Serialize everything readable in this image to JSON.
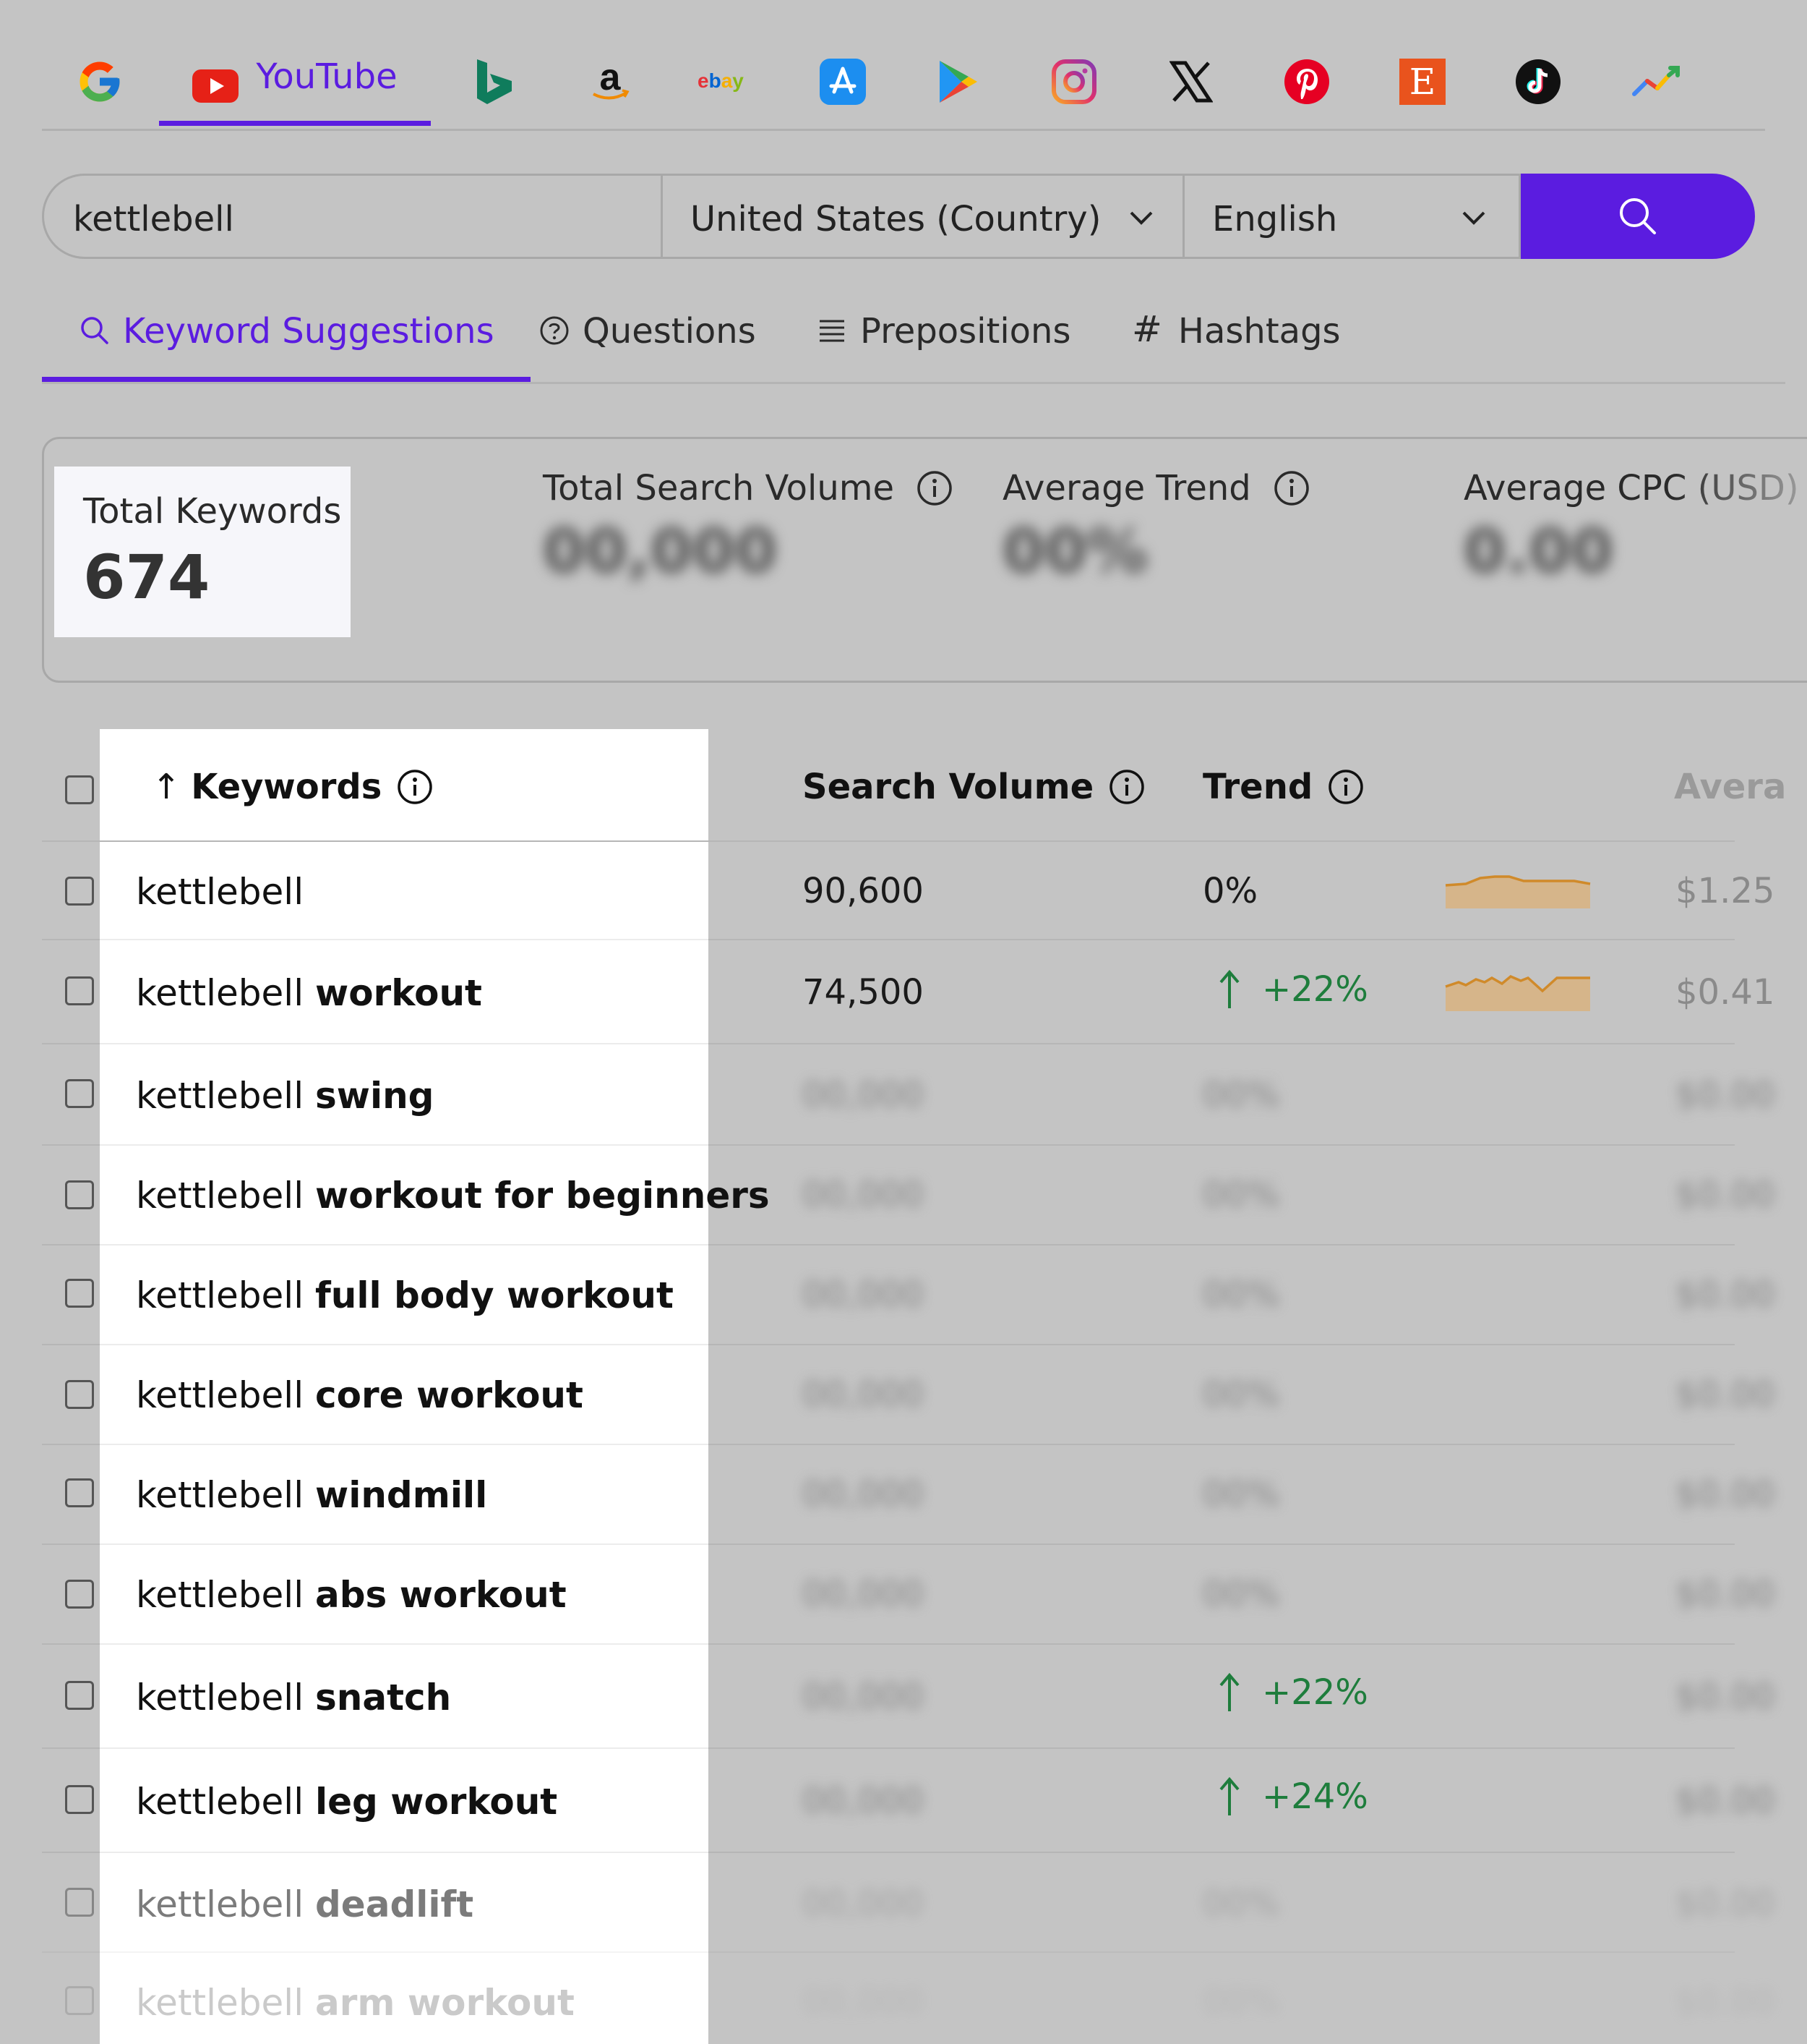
{
  "platforms": {
    "items": [
      {
        "id": "google",
        "icon": "google-icon"
      },
      {
        "id": "youtube",
        "icon": "youtube-icon",
        "label": "YouTube",
        "active": true
      },
      {
        "id": "bing",
        "icon": "bing-icon"
      },
      {
        "id": "amazon",
        "icon": "amazon-icon"
      },
      {
        "id": "ebay",
        "icon": "ebay-icon",
        "label": "ebay"
      },
      {
        "id": "appstore",
        "icon": "app-store-icon"
      },
      {
        "id": "playstore",
        "icon": "play-store-icon"
      },
      {
        "id": "instagram",
        "icon": "instagram-icon"
      },
      {
        "id": "x",
        "icon": "x-icon"
      },
      {
        "id": "pinterest",
        "icon": "pinterest-icon"
      },
      {
        "id": "etsy",
        "icon": "etsy-icon",
        "label": "E"
      },
      {
        "id": "tiktok",
        "icon": "tiktok-icon"
      },
      {
        "id": "trends",
        "icon": "trends-icon"
      }
    ]
  },
  "search": {
    "query": "kettlebell",
    "country": "United States (Country)",
    "language": "English",
    "button_icon": "search-icon"
  },
  "subtabs": [
    {
      "label": "Keyword Suggestions",
      "icon": "search-icon",
      "active": true
    },
    {
      "label": "Questions",
      "icon": "question-icon"
    },
    {
      "label": "Prepositions",
      "icon": "list-icon"
    },
    {
      "label": "Hashtags",
      "icon": "hash-icon",
      "glyph": "#"
    }
  ],
  "stats": {
    "total_keywords_label": "Total Keywords",
    "total_keywords_value": "674",
    "total_search_volume_label": "Total Search Volume",
    "total_search_volume_value": "00,000",
    "average_trend_label": "Average Trend",
    "average_trend_value": "00%",
    "average_cpc_label": "Average CPC (USD)",
    "average_cpc_value": "0.00"
  },
  "table": {
    "headers": {
      "sort_arrow": "↑",
      "keywords": "Keywords",
      "search_volume": "Search Volume",
      "trend": "Trend",
      "cpc": "Avera"
    },
    "rows": [
      {
        "base": "kettlebell",
        "suffix": "",
        "volume": "90,600",
        "trend": "0%",
        "trend_dir": "flat",
        "cpc": "$1.25",
        "spark": "flat"
      },
      {
        "base": "kettlebell",
        "suffix": "workout",
        "volume": "74,500",
        "trend": "+22%",
        "trend_dir": "up",
        "cpc": "$0.41",
        "spark": "wavy"
      },
      {
        "base": "kettlebell",
        "suffix": "swing",
        "volume": "00,000",
        "trend": "00%",
        "trend_dir": "hidden",
        "cpc": "$0.00"
      },
      {
        "base": "kettlebell",
        "suffix": "workout for beginners",
        "volume": "00,000",
        "trend": "00%",
        "trend_dir": "hidden",
        "cpc": "$0.00"
      },
      {
        "base": "kettlebell",
        "suffix": "full body workout",
        "volume": "00,000",
        "trend": "00%",
        "trend_dir": "hidden",
        "cpc": "$0.00"
      },
      {
        "base": "kettlebell",
        "suffix": "core workout",
        "volume": "00,000",
        "trend": "00%",
        "trend_dir": "hidden",
        "cpc": "$0.00"
      },
      {
        "base": "kettlebell",
        "suffix": "windmill",
        "volume": "00,000",
        "trend": "00%",
        "trend_dir": "hidden",
        "cpc": "$0.00"
      },
      {
        "base": "kettlebell",
        "suffix": "abs workout",
        "volume": "00,000",
        "trend": "00%",
        "trend_dir": "hidden",
        "cpc": "$0.00"
      },
      {
        "base": "kettlebell",
        "suffix": "snatch",
        "volume": "00,000",
        "trend": "+22%",
        "trend_dir": "up",
        "cpc": "$0.00"
      },
      {
        "base": "kettlebell",
        "suffix": "leg workout",
        "volume": "00,000",
        "trend": "+24%",
        "trend_dir": "up",
        "cpc": "$0.00"
      },
      {
        "base": "kettlebell",
        "suffix": "deadlift",
        "volume": "00,000",
        "trend": "00%",
        "trend_dir": "hidden",
        "cpc": "$0.00"
      },
      {
        "base": "kettlebell",
        "suffix": "arm workout",
        "volume": "00,000",
        "trend": "00%",
        "trend_dir": "hidden",
        "cpc": "$0.00"
      }
    ]
  },
  "colors": {
    "accent": "#5b1ce0",
    "trend_up": "#1e7d3c",
    "spark_stroke": "#d08a2a",
    "spark_fill": "#d6b58a",
    "overlay_gray": "#c4c4c4"
  }
}
